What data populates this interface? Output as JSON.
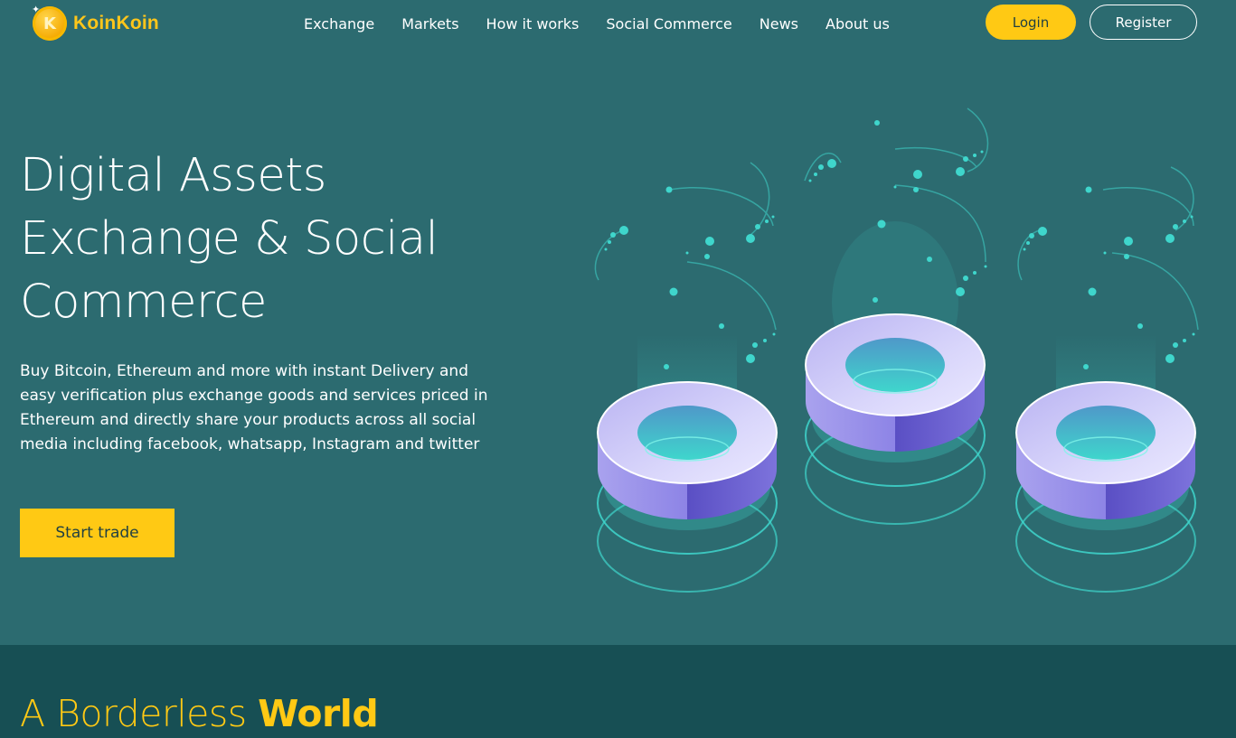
{
  "brand": {
    "name": "KoinKoin",
    "logo_letter": "K"
  },
  "nav": {
    "links": [
      {
        "label": "Exchange"
      },
      {
        "label": "Markets"
      },
      {
        "label": "How it works"
      },
      {
        "label": "Social Commerce"
      },
      {
        "label": "News"
      },
      {
        "label": "About us"
      }
    ],
    "login_label": "Login",
    "register_label": "Register"
  },
  "hero": {
    "title_lines": [
      "Digital Assets",
      "Exchange & Social",
      "Commerce"
    ],
    "description": "Buy Bitcoin, Ethereum and more with instant Delivery and easy verification plus exchange goods and services priced in Ethereum and directly share your products across all social media including facebook, whatsapp, Instagram and twitter",
    "cta_label": "Start trade"
  },
  "section": {
    "heading_light": "A Borderless ",
    "heading_bold": "World"
  },
  "colors": {
    "background": "#2c6b70",
    "accent": "#ffc914",
    "band": "#174f54",
    "glow": "#3fd6cc"
  },
  "icons": [
    "coin-logo-icon",
    "sparkle-icon"
  ]
}
